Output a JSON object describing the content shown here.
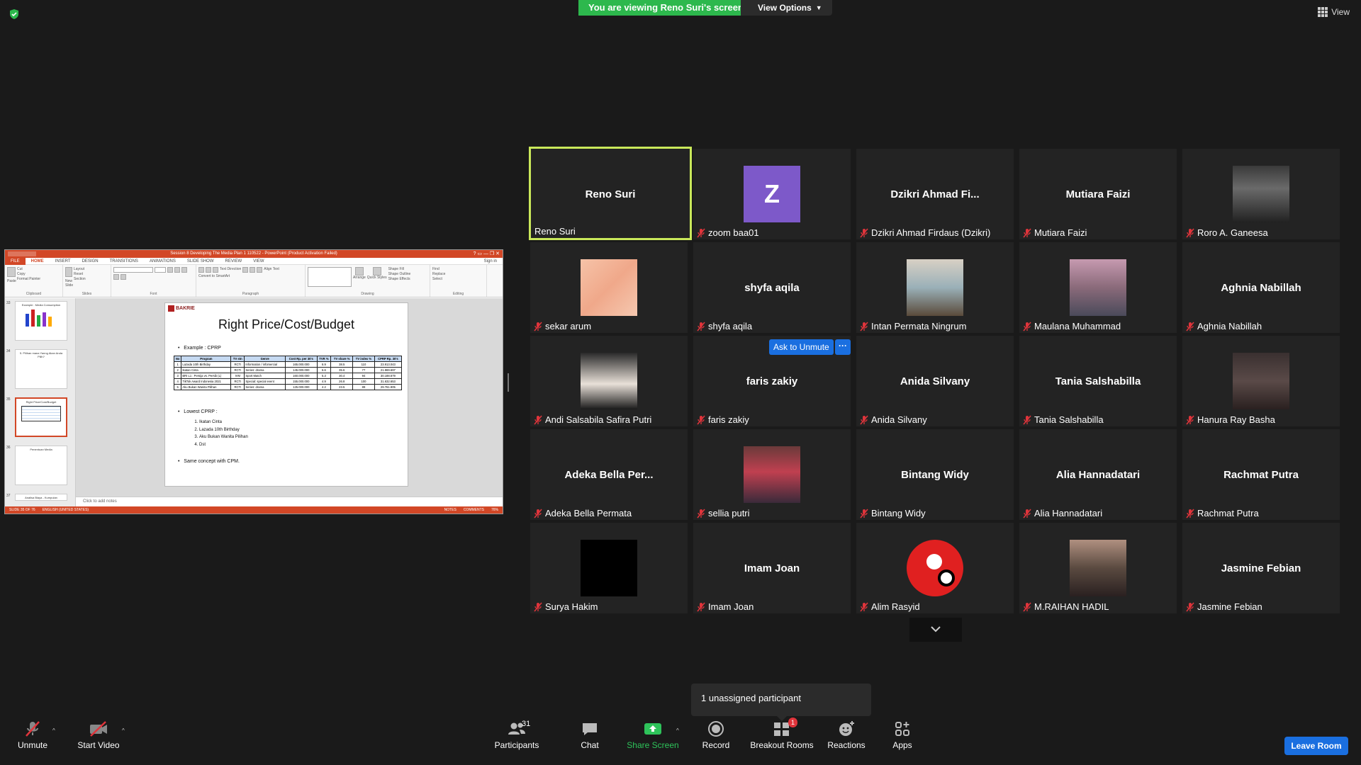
{
  "top": {
    "banner": "You are viewing Reno Suri's screen",
    "view_options": "View Options",
    "view": "View"
  },
  "ppt": {
    "window_title": "Session 8 Developing The Media Plan 1 110522 - PowerPoint (Product Activation Failed)",
    "tabs": [
      "FILE",
      "HOME",
      "INSERT",
      "DESIGN",
      "TRANSITIONS",
      "ANIMATIONS",
      "SLIDE SHOW",
      "REVIEW",
      "VIEW"
    ],
    "sign_in": "Sign in",
    "ribbon_groups": [
      "Clipboard",
      "Slides",
      "Font",
      "Paragraph",
      "Drawing",
      "Editing"
    ],
    "ribbon_texts": {
      "cut": "Cut",
      "copy": "Copy",
      "format_painter": "Format Painter",
      "paste": "Paste",
      "layout": "Layout",
      "reset": "Reset",
      "section": "Section",
      "new_slide": "New Slide",
      "text_direction": "Text Direction",
      "align_text": "Align Text",
      "convert": "Convert to SmartArt",
      "arrange": "Arrange",
      "quick_styles": "Quick Styles",
      "shape_fill": "Shape Fill",
      "shape_outline": "Shape Outline",
      "shape_effects": "Shape Effects",
      "find": "Find",
      "replace": "Replace",
      "select": "Select"
    },
    "thumbs": [
      {
        "num": "33",
        "text": "Example : Media Consumption"
      },
      {
        "num": "34",
        "text": "5. Pilihan mana Yanng Akan Anda Pilih?"
      },
      {
        "num": "35",
        "text": "Right Price/Cost/Budget"
      },
      {
        "num": "36",
        "text": "Penentuan Media"
      },
      {
        "num": "37",
        "text": "Analisa Biaya - Kumpulan"
      }
    ],
    "notes": "Click to add notes",
    "status_left": "SLIDE 35 OF 76",
    "status_lang": "ENGLISH (UNITED STATES)",
    "status_notes": "NOTES",
    "status_comments": "COMMENTS",
    "zoom": "76%",
    "slide": {
      "logo": "BAKRIE",
      "title": "Right Price/Cost/Budget",
      "bullet1": "Example : CPRP",
      "table_headers": [
        "No",
        "Program",
        "TV stn",
        "Genre",
        "Cost Rp. per 30's",
        "TVR %",
        "TV share %",
        "TV index %",
        "CPRP Rp. 30's"
      ],
      "table_rows": [
        [
          "1",
          "Lazada 10th Birthday",
          "RCTI",
          "Information / infomercial",
          "165.000.000",
          "6.9",
          "38.5",
          "110",
          "23.913.043"
        ],
        [
          "2",
          "Ikatan Cinta",
          "RCTI",
          "Series: drama",
          "145.000.000",
          "6.6",
          "35.6",
          "77",
          "21.969.697"
        ],
        [
          "3",
          "BRI L1 : Persija vs. Persib (L)",
          "IVM",
          "Sport Match",
          "160.000.000",
          "5.3",
          "30.4",
          "94",
          "30.188.679"
        ],
        [
          "4",
          "TikTok Award Indonesia 2021",
          "RCTI",
          "Special: special event",
          "155.000.000",
          "4.9",
          "26.8",
          "100",
          "31.632.653"
        ],
        [
          "5",
          "Aku Bukan Wanita Pilihan",
          "RCTI",
          "Series: drama",
          "125.000.000",
          "4.2",
          "23.5",
          "89",
          "29.761.905"
        ]
      ],
      "bullet2": "Lowest CPRP :",
      "list": [
        "Ikatan Cinta",
        "Lazada 10th Birthday",
        "Aku Bukan Wanita Pilihan",
        "Dst"
      ],
      "bullet3": "Same concept with CPM."
    }
  },
  "participants": [
    {
      "big": "Reno Suri",
      "label": "Reno Suri",
      "active": true,
      "muted": false,
      "avatar": "none"
    },
    {
      "big": "",
      "label": "zoom baa01",
      "muted": true,
      "avatar": "letter",
      "letter": "Z"
    },
    {
      "big": "Dzikri Ahmad Fi...",
      "label": "Dzikri Ahmad Firdaus (Dzikri)",
      "muted": true,
      "avatar": "none"
    },
    {
      "big": "Mutiara Faizi",
      "label": "Mutiara Faizi",
      "muted": true,
      "avatar": "none"
    },
    {
      "big": "",
      "label": "Roro A. Ganeesa",
      "muted": true,
      "avatar": "photo1"
    },
    {
      "big": "",
      "label": "sekar arum",
      "muted": true,
      "avatar": "peach"
    },
    {
      "big": "shyfa aqila",
      "label": "shyfa aqila",
      "muted": true,
      "avatar": "none"
    },
    {
      "big": "",
      "label": "Intan Permata Ningrum",
      "muted": true,
      "avatar": "photo2"
    },
    {
      "big": "",
      "label": "Maulana Muhammad",
      "muted": true,
      "avatar": "photo3"
    },
    {
      "big": "Aghnia Nabillah",
      "label": "Aghnia Nabillah",
      "muted": true,
      "avatar": "none"
    },
    {
      "big": "",
      "label": "Andi Salsabila Safira Putri",
      "muted": true,
      "avatar": "photo4"
    },
    {
      "big": "faris zakiy",
      "label": "faris zakiy",
      "muted": true,
      "avatar": "none"
    },
    {
      "big": "Anida Silvany",
      "label": "Anida Silvany",
      "muted": true,
      "avatar": "none"
    },
    {
      "big": "Tania Salshabilla",
      "label": "Tania Salshabilla",
      "muted": true,
      "avatar": "none"
    },
    {
      "big": "",
      "label": "Hanura Ray Basha",
      "muted": true,
      "avatar": "photo5"
    },
    {
      "big": "Adeka Bella Per...",
      "label": "Adeka Bella Permata",
      "muted": true,
      "avatar": "none"
    },
    {
      "big": "",
      "label": "sellia putri",
      "muted": true,
      "avatar": "photo6"
    },
    {
      "big": "Bintang Widy",
      "label": "Bintang Widy",
      "muted": true,
      "avatar": "none"
    },
    {
      "big": "Alia Hannadatari",
      "label": "Alia Hannadatari",
      "muted": true,
      "avatar": "none"
    },
    {
      "big": "Rachmat Putra",
      "label": "Rachmat Putra",
      "muted": true,
      "avatar": "none"
    },
    {
      "big": "",
      "label": "Surya Hakim",
      "muted": true,
      "avatar": "black"
    },
    {
      "big": "Imam Joan",
      "label": "Imam Joan",
      "muted": true,
      "avatar": "none"
    },
    {
      "big": "",
      "label": "Alim Rasyid",
      "muted": true,
      "avatar": "red"
    },
    {
      "big": "",
      "label": "M.RAIHAN HADIL",
      "muted": true,
      "avatar": "photo7"
    },
    {
      "big": "Jasmine Febian",
      "label": "Jasmine Febian",
      "muted": true,
      "avatar": "none"
    }
  ],
  "hover": {
    "ask_unmute": "Ask to Unmute",
    "more": "···"
  },
  "unassigned": "1 unassigned participant",
  "toolbar": {
    "unmute": "Unmute",
    "start_video": "Start Video",
    "participants": "Participants",
    "participant_count": "31",
    "chat": "Chat",
    "share_screen": "Share Screen",
    "record": "Record",
    "breakout_rooms": "Breakout Rooms",
    "breakout_badge": "1",
    "reactions": "Reactions",
    "apps": "Apps",
    "leave_room": "Leave Room"
  },
  "colors": {
    "accent_green": "#2db84d",
    "active_border": "#c9e85a",
    "blue": "#1a6fe0",
    "ppt_red": "#d24726"
  }
}
